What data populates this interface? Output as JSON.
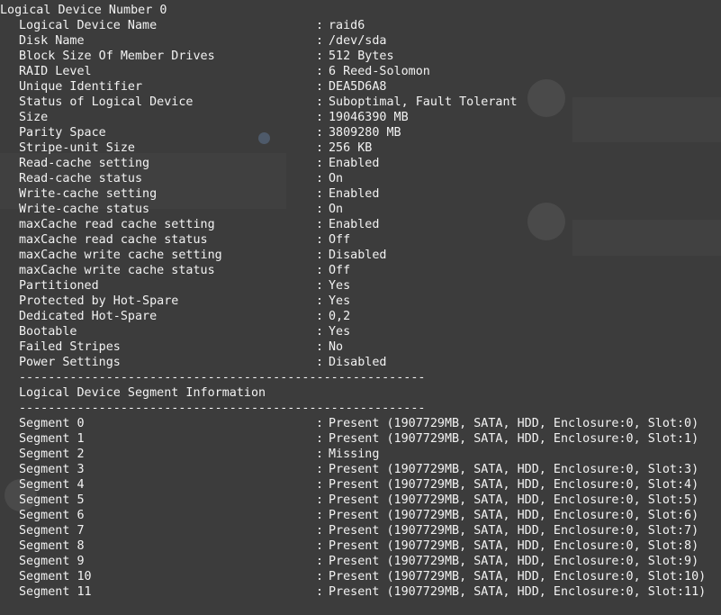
{
  "header": "Logical Device Number 0",
  "properties": [
    {
      "label": "Logical Device Name",
      "value": "raid6"
    },
    {
      "label": "Disk Name",
      "value": "/dev/sda"
    },
    {
      "label": "Block Size Of Member Drives",
      "value": "512 Bytes"
    },
    {
      "label": "RAID Level",
      "value": "6 Reed-Solomon"
    },
    {
      "label": "Unique Identifier",
      "value": "DEA5D6A8"
    },
    {
      "label": "Status of Logical Device",
      "value": "Suboptimal, Fault Tolerant"
    },
    {
      "label": "Size",
      "value": "19046390 MB"
    },
    {
      "label": "Parity Space",
      "value": "3809280 MB"
    },
    {
      "label": "Stripe-unit Size",
      "value": "256 KB"
    },
    {
      "label": "Read-cache setting",
      "value": "Enabled"
    },
    {
      "label": "Read-cache status",
      "value": "On"
    },
    {
      "label": "Write-cache setting",
      "value": "Enabled"
    },
    {
      "label": "Write-cache status",
      "value": "On"
    },
    {
      "label": "maxCache read cache setting",
      "value": "Enabled"
    },
    {
      "label": "maxCache read cache status",
      "value": "Off"
    },
    {
      "label": "maxCache write cache setting",
      "value": "Disabled"
    },
    {
      "label": "maxCache write cache status",
      "value": "Off"
    },
    {
      "label": "Partitioned",
      "value": "Yes"
    },
    {
      "label": "Protected by Hot-Spare",
      "value": "Yes"
    },
    {
      "label": "Dedicated Hot-Spare",
      "value": "0,2"
    },
    {
      "label": "Bootable",
      "value": "Yes"
    },
    {
      "label": "Failed Stripes",
      "value": "No"
    },
    {
      "label": "Power Settings",
      "value": "Disabled"
    }
  ],
  "separator": "--------------------------------------------------------",
  "segment_section_title": "Logical Device Segment Information",
  "segments": [
    {
      "label": "Segment 0",
      "value": "Present (1907729MB, SATA, HDD, Enclosure:0, Slot:0)"
    },
    {
      "label": "Segment 1",
      "value": "Present (1907729MB, SATA, HDD, Enclosure:0, Slot:1)"
    },
    {
      "label": "Segment 2",
      "value": "Missing"
    },
    {
      "label": "Segment 3",
      "value": "Present (1907729MB, SATA, HDD, Enclosure:0, Slot:3)"
    },
    {
      "label": "Segment 4",
      "value": "Present (1907729MB, SATA, HDD, Enclosure:0, Slot:4)"
    },
    {
      "label": "Segment 5",
      "value": "Present (1907729MB, SATA, HDD, Enclosure:0, Slot:5)"
    },
    {
      "label": "Segment 6",
      "value": "Present (1907729MB, SATA, HDD, Enclosure:0, Slot:6)"
    },
    {
      "label": "Segment 7",
      "value": "Present (1907729MB, SATA, HDD, Enclosure:0, Slot:7)"
    },
    {
      "label": "Segment 8",
      "value": "Present (1907729MB, SATA, HDD, Enclosure:0, Slot:8)"
    },
    {
      "label": "Segment 9",
      "value": "Present (1907729MB, SATA, HDD, Enclosure:0, Slot:9)"
    },
    {
      "label": "Segment 10",
      "value": "Present (1907729MB, SATA, HDD, Enclosure:0, Slot:10)"
    },
    {
      "label": "Segment 11",
      "value": "Present (1907729MB, SATA, HDD, Enclosure:0, Slot:11)"
    }
  ],
  "colors": {
    "background": "#3c3c3c",
    "text": "#f2f2f2"
  }
}
